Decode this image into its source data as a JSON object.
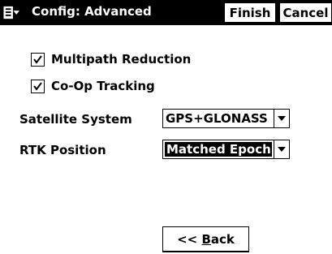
{
  "titlebar": {
    "title": "Config: Advanced",
    "finish_label": "Finish",
    "cancel_label": "Cancel",
    "start_icon": "start-menu-icon"
  },
  "options": {
    "multipath_label": "Multipath Reduction",
    "multipath_checked": true,
    "coop_label": "Co-Op Tracking",
    "coop_checked": true
  },
  "fields": {
    "satellite_label": "Satellite System",
    "satellite_value": "GPS+GLONASS",
    "rtk_label": "RTK Position",
    "rtk_value": "Matched Epoch"
  },
  "footer": {
    "back_prefix": "<< ",
    "back_accel": "B",
    "back_rest": "ack"
  },
  "colors": {
    "titlebar_bg": "#000000",
    "background": "#ffffff"
  }
}
